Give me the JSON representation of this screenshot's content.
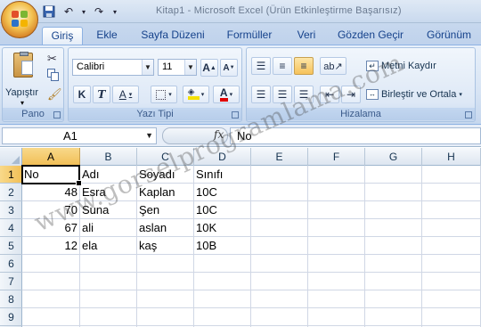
{
  "app": {
    "office_button_icon": "office-logo-icon",
    "title": "Kitap1 - Microsoft Excel (Ürün Etkinleştirme Başarısız)",
    "quick_access": [
      "save-icon",
      "undo-icon",
      "redo-icon",
      "customize-qat-icon"
    ]
  },
  "tabs": [
    {
      "label": "Giriş",
      "active": true
    },
    {
      "label": "Ekle"
    },
    {
      "label": "Sayfa Düzeni"
    },
    {
      "label": "Formüller"
    },
    {
      "label": "Veri"
    },
    {
      "label": "Gözden Geçir"
    },
    {
      "label": "Görünüm"
    }
  ],
  "ribbon": {
    "pano": {
      "label": "Pano",
      "paste_label": "Yapıştır"
    },
    "font": {
      "label": "Yazı Tipi",
      "font_name": "Calibri",
      "font_size": "11",
      "grow_label": "A",
      "shrink_label": "A",
      "bold": "K",
      "italic": "T",
      "underline": "A",
      "font_color_label": "A"
    },
    "alignment": {
      "label": "Hizalama",
      "wrap_text": "Metni Kaydır",
      "merge_center": "Birleştir ve Ortala"
    }
  },
  "formula_bar": {
    "name_box": "A1",
    "fx": "fx",
    "value": "No"
  },
  "columns": [
    "A",
    "B",
    "C",
    "D",
    "E",
    "F",
    "G",
    "H"
  ],
  "rows": [
    "1",
    "2",
    "3",
    "4",
    "5",
    "6",
    "7",
    "8",
    "9"
  ],
  "active_cell": "A1",
  "cells": {
    "A1": "No",
    "B1": "Adı",
    "C1": "Soyadı",
    "D1": "Sınıfı",
    "A2": "48",
    "B2": "Esra",
    "C2": "Kaplan",
    "D2": "10C",
    "A3": "70",
    "B3": "Suna",
    "C3": "Şen",
    "D3": "10C",
    "A4": "67",
    "B4": "ali",
    "C4": "aslan",
    "D4": "10K",
    "A5": "12",
    "B5": "ela",
    "C5": "kaş",
    "D5": "10B"
  },
  "watermark": "www.gorselprogramlama.com",
  "colors": {
    "accent": "#f1be55",
    "ribbon_text": "#15428b",
    "grid": "#d0d7e5"
  }
}
